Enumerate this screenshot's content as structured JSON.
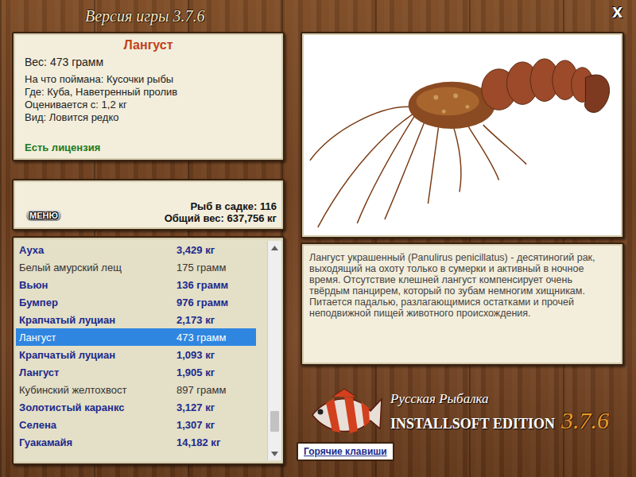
{
  "window": {
    "title": "Версия игры 3.7.6",
    "close": "X"
  },
  "fish_card": {
    "name": "Лангуст",
    "weight": "Вес: 473 грамм",
    "details": [
      "На что поймана: Кусочки рыбы",
      "Где: Куба, Наветренный пролив",
      "Оценивается с: 1,2 кг",
      "Вид: Ловится редко"
    ],
    "license": "Есть лицензия"
  },
  "keepnet": {
    "menu_button": "МЕНЮ",
    "count": "Рыб в садке: 116",
    "total_weight": "Общий вес: 637,756 кг"
  },
  "catch_list": {
    "scroll_position": 0.92,
    "rows": [
      {
        "name": "Ауха",
        "weight": "3,429 кг",
        "bold": true,
        "selected": false
      },
      {
        "name": "Белый амурский лещ",
        "weight": "175 грамм",
        "bold": false,
        "selected": false
      },
      {
        "name": "Вьюн",
        "weight": "136 грамм",
        "bold": true,
        "selected": false
      },
      {
        "name": "Бумпер",
        "weight": "976 грамм",
        "bold": true,
        "selected": false
      },
      {
        "name": "Крапчатый луциан",
        "weight": "2,173 кг",
        "bold": true,
        "selected": false
      },
      {
        "name": "Лангуст",
        "weight": "473 грамм",
        "bold": false,
        "selected": true
      },
      {
        "name": "Крапчатый луциан",
        "weight": "1,093 кг",
        "bold": true,
        "selected": false
      },
      {
        "name": "Лангуст",
        "weight": "1,905 кг",
        "bold": true,
        "selected": false
      },
      {
        "name": "Кубинский желтохвост",
        "weight": "897 грамм",
        "bold": false,
        "selected": false
      },
      {
        "name": "Золотистый каранкс",
        "weight": "3,127 кг",
        "bold": true,
        "selected": false
      },
      {
        "name": "Селена",
        "weight": "1,307 кг",
        "bold": true,
        "selected": false
      },
      {
        "name": "Гуакамайя",
        "weight": "14,182 кг",
        "bold": true,
        "selected": false
      }
    ]
  },
  "description": "Лангуст украшенный (Panulirus penicillatus) - десятиногий рак, выходящий на охоту только в сумерки и активный в ночное время. Отсутствие клешней лангуст компенсирует очень твёрдым панцирем, который по зубам немногим хищникам. Питается падалью, разлагающимися остатками и прочей неподвижной пищей животного происхождения.",
  "logo": {
    "title": "Русская Рыбалка",
    "edition": "INSTALLSOFT EDITION",
    "version": "3.7.6"
  },
  "hotkeys_button": "Горячие клавиши"
}
